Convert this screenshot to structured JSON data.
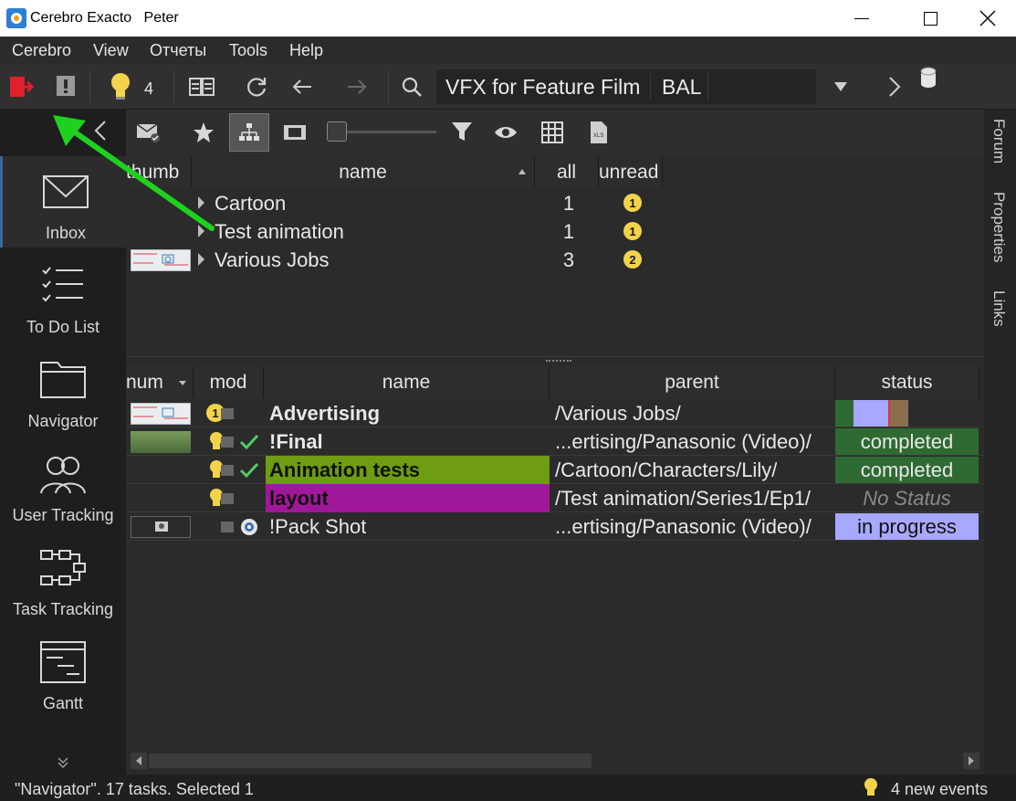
{
  "window": {
    "app_title": "Cerebro Exacto",
    "user": "Peter"
  },
  "menu": [
    "Cerebro",
    "View",
    "Отчеты",
    "Tools",
    "Help"
  ],
  "toolbar": {
    "events_count": "4",
    "project": "VFX for Feature Film",
    "project_code": "BAL"
  },
  "right_tabs": [
    "Forum",
    "Properties",
    "Links"
  ],
  "sidebar": [
    {
      "label": "Inbox",
      "icon": "envelope-icon"
    },
    {
      "label": "To Do List",
      "icon": "checklist-icon"
    },
    {
      "label": "Navigator",
      "icon": "folder-icon"
    },
    {
      "label": "User Tracking",
      "icon": "users-icon"
    },
    {
      "label": "Task Tracking",
      "icon": "flowchart-icon"
    },
    {
      "label": "Gantt",
      "icon": "gantt-icon"
    }
  ],
  "upper_table": {
    "headers": {
      "thumb": "thumb",
      "name": "name",
      "all": "all",
      "unread": "unread"
    },
    "rows": [
      {
        "name": "Cartoon",
        "all": "1",
        "unread": "1"
      },
      {
        "name": "Test animation",
        "all": "1",
        "unread": "1"
      },
      {
        "name": "Various Jobs",
        "all": "3",
        "unread": "2"
      }
    ]
  },
  "lower_table": {
    "headers": {
      "num": "num",
      "mod": "mod",
      "name": "name",
      "parent": "parent",
      "status": "status"
    },
    "rows": [
      {
        "name": "Advertising",
        "parent": "/Various Jobs/",
        "status": "",
        "badge": "1"
      },
      {
        "name": "!Final",
        "parent": "...ertising/Panasonic (Video)/",
        "status": "completed"
      },
      {
        "name": "Animation tests",
        "parent": "/Cartoon/Characters/Lily/",
        "status": "completed"
      },
      {
        "name": "layout",
        "parent": "/Test animation/Series1/Ep1/",
        "status": "No Status"
      },
      {
        "name": "!Pack Shot",
        "parent": "...ertising/Panasonic (Video)/",
        "status": "in progress"
      }
    ]
  },
  "statusbar": {
    "left": "\"Navigator\". 17 tasks. Selected 1",
    "right": "4 new events"
  },
  "colors": {
    "completed": "#2f6a33",
    "in_progress": "#a8a8ff",
    "animation_tests_bg": "#6e9c12",
    "layout_bg": "#a0189a",
    "arrow": "#1fd11f"
  }
}
